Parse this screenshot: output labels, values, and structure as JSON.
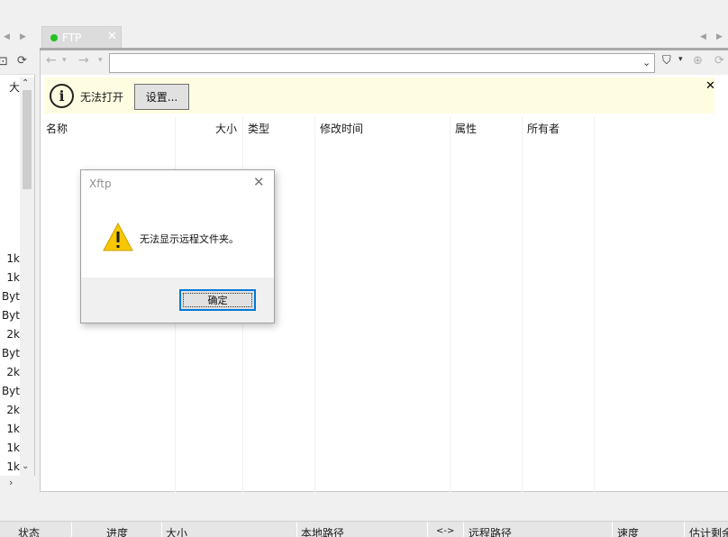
{
  "tab": {
    "label": "FTP",
    "close": "✕",
    "status_color": "#22c022"
  },
  "left_pane": {
    "header": "大",
    "rows": [
      "1k",
      "1k",
      "Byt",
      "Byt",
      "2k",
      "Byt",
      "2k",
      "Byt",
      "2k",
      "1k",
      "1k",
      "1k"
    ]
  },
  "address": {
    "value": ""
  },
  "info_bar": {
    "icon_glyph": "i",
    "text": "无法打开",
    "settings_label": "设置...",
    "close": "✕"
  },
  "columns": {
    "name": "名称",
    "size": "大小",
    "type": "类型",
    "modified": "修改时间",
    "attributes": "属性",
    "owner": "所有者"
  },
  "dialog": {
    "title": "Xftp",
    "message": "无法显示远程文件夹。",
    "ok_label": "确定",
    "close": "✕"
  },
  "transfer": {
    "columns": [
      "状态",
      "进度",
      "大小",
      "本地路径",
      "<->",
      "远程路径",
      "速度",
      "估计剩余"
    ]
  },
  "colors": {
    "info_bg": "#fffde1",
    "accent": "#0078d7",
    "warning": "#f7c800"
  }
}
